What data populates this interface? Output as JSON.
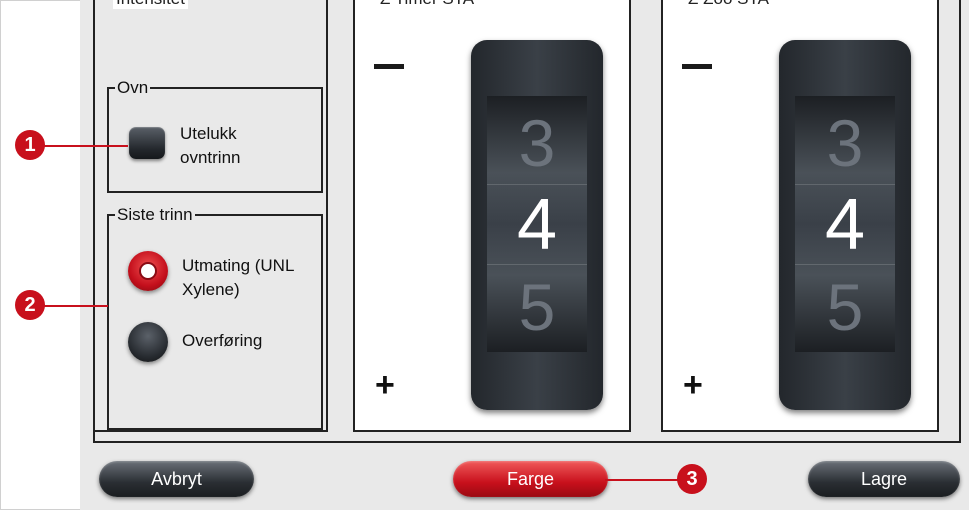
{
  "columns": {
    "left_title": "Intensitet",
    "mid_title": "Z Timer STA",
    "right_title": "Z Zoo STA"
  },
  "oven_group": {
    "legend": "Ovn",
    "option_label": "Utelukk ovntrinn",
    "checked": false
  },
  "last_step_group": {
    "legend": "Siste trinn",
    "options": [
      {
        "label": "Utmating (UNL Xylene)",
        "selected": true
      },
      {
        "label": "Overføring",
        "selected": false
      }
    ]
  },
  "spinner_left": {
    "minus": "−",
    "plus": "+",
    "prev": "3",
    "current": "4",
    "next": "5"
  },
  "spinner_right": {
    "minus": "−",
    "plus": "+",
    "prev": "3",
    "current": "4",
    "next": "5"
  },
  "buttons": {
    "cancel": "Avbryt",
    "color": "Farge",
    "save": "Lagre"
  },
  "callouts": [
    "1",
    "2",
    "3"
  ],
  "colors": {
    "accent_red": "#c8101c",
    "dark_control": "#2a2e33",
    "panel_bg": "#e9e9e9"
  }
}
